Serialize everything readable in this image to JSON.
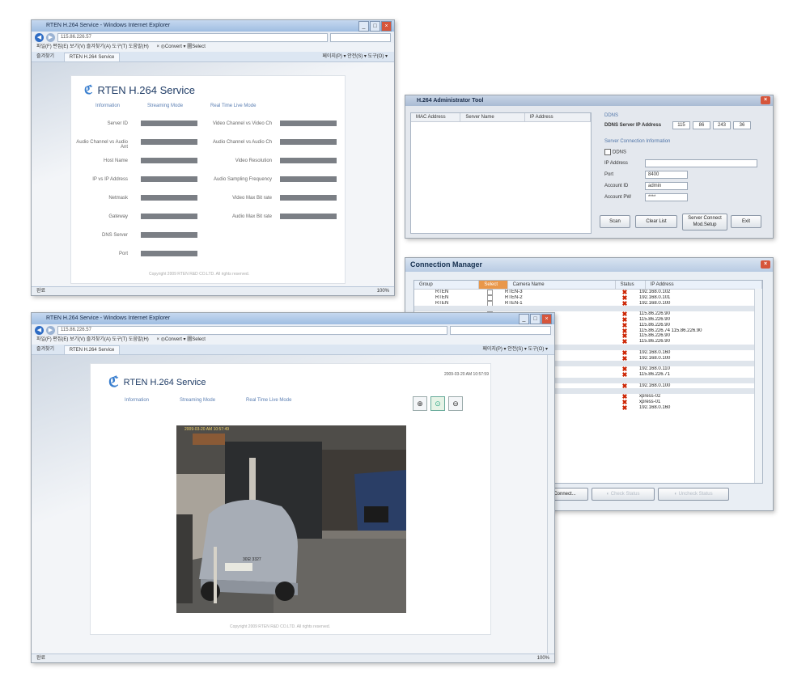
{
  "browser": {
    "title": "RTEN H.264 Service - Windows Internet Explorer",
    "menu": "파일(F)  편집(E)  보기(V)  즐겨찾기(A)  도구(T)  도움말(H)",
    "toolbar_extra": "× ◎Convert ▾ 圖Select",
    "favorites": "즐겨찾기",
    "tab_label": "RTEN H.264 Service",
    "tools": "페이지(P) ▾  안전(S) ▾  도구(O) ▾",
    "status_right": "100%",
    "url_top": "115.86.226.57",
    "url_bottom": "115.86.226.57"
  },
  "service": {
    "logo": "RTEN H.264 Service",
    "tabs": [
      "Information",
      "Streaming Mode",
      "Real Time Live Mode"
    ],
    "copyright": "Copyright 2009 RTEN R&D CO.LTD. All rights reserved.",
    "left_fields": [
      "Server ID",
      "Audio Channel vs Audio Ant",
      "Host Name",
      "IP vs IP Address",
      "Netmask",
      "Gateway",
      "DNS Server",
      "Port"
    ],
    "right_fields": [
      "Video Channel vs Video Ch",
      "Audio Channel vs Audio Ch",
      "Video Resolution",
      "Audio Sampling Frequency",
      "Video Max Bit rate",
      "Audio Max Bit rate"
    ],
    "timestamp": "2009-03-20 AM 10:57:59"
  },
  "admin": {
    "title": "H.264 Administrator Tool",
    "columns": [
      "MAC Address",
      "Server Name",
      "IP Address"
    ],
    "ddns_section": "DDNS",
    "ddns_label": "DDNS Server IP Address",
    "ddns_ip": [
      "115",
      "86",
      "243",
      "36"
    ],
    "conn_section": "Server Connection Information",
    "ddns_check": "DDNS",
    "ip_label": "IP Address",
    "port_label": "Port",
    "port_value": "8400",
    "account_label": "Account ID",
    "account_value": "admin",
    "pw_label": "Account PW",
    "pw_value": "****",
    "buttons": [
      "Scan",
      "Clear List",
      "Server Connect Mod.Setup",
      "Exit"
    ]
  },
  "connmgr": {
    "title": "Connection Manager",
    "columns": [
      "Group",
      "Select",
      "Camera Name",
      "Status",
      "IP Address"
    ],
    "rows": [
      {
        "group": "RTEN",
        "camera": "RTEN-3",
        "ip": "192.168.0.102"
      },
      {
        "group": "RTEN",
        "camera": "RTEN-2",
        "ip": "192.168.0.101"
      },
      {
        "group": "RTEN",
        "camera": "RTEN-1",
        "ip": "192.168.0.100"
      },
      {
        "group": "",
        "camera": "",
        "ip": ""
      },
      {
        "group": "",
        "camera": "",
        "ip": "115.86.226.90"
      },
      {
        "group": "",
        "camera": "",
        "ip": "115.86.226.90"
      },
      {
        "group": "",
        "camera": "",
        "ip": "115.86.226.90"
      },
      {
        "group": "",
        "camera": "",
        "ip": "115.86.226.74 115.86.226.90"
      },
      {
        "group": "",
        "camera": "",
        "ip": "115.86.226.90"
      },
      {
        "group": "",
        "camera": "",
        "ip": "115.86.226.90"
      },
      {
        "group": "",
        "camera": "",
        "ip": ""
      },
      {
        "group": "",
        "camera": "",
        "ip": "192.168.0.160"
      },
      {
        "group": "",
        "camera": "",
        "ip": "192.168.0.100"
      },
      {
        "group": "",
        "camera": "",
        "ip": ""
      },
      {
        "group": "",
        "camera": "",
        "ip": "192.168.0.110"
      },
      {
        "group": "",
        "camera": "",
        "ip": "115.86.226.71"
      },
      {
        "group": "",
        "camera": "",
        "ip": ""
      },
      {
        "group": "",
        "camera": "",
        "ip": "192.168.0.100"
      },
      {
        "group": "",
        "camera": "",
        "ip": ""
      },
      {
        "group": "",
        "camera": "",
        "ip": "xpress-02"
      },
      {
        "group": "",
        "camera": "",
        "ip": "xpress-01"
      },
      {
        "group": "",
        "camera": "",
        "ip": "192.168.0.160"
      }
    ],
    "buttons": [
      "Connect",
      "Check Status",
      "Uncheck Status"
    ]
  },
  "camera": {
    "overlay": "2009-03-20 AM 10:57:49",
    "plate": "30모 3327"
  }
}
